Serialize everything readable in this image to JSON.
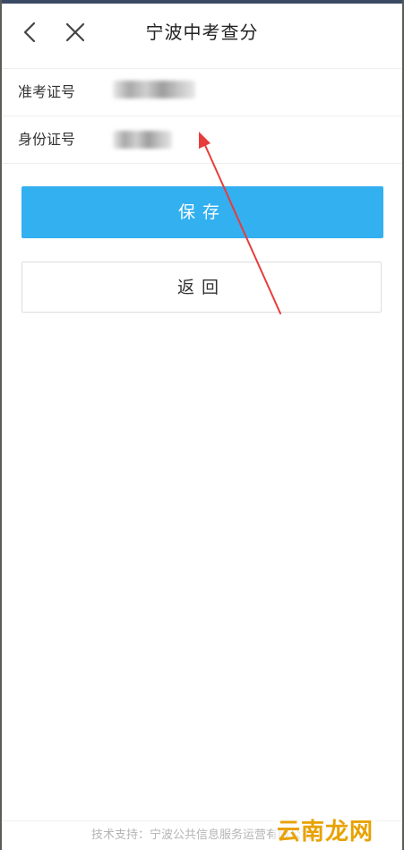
{
  "window": {
    "title": "宁波中考查分"
  },
  "icons": {
    "back": "chevron-left-icon",
    "close": "close-icon"
  },
  "form": {
    "exam_number_label": "准考证号",
    "exam_number_value": "",
    "id_number_label": "身份证号",
    "id_number_value": ""
  },
  "buttons": {
    "save_label": "保存",
    "back_label": "返回"
  },
  "footer": {
    "text": "技术支持：宁波公共信息服务运营有限公司"
  },
  "watermark": {
    "text": "云南龙网"
  },
  "colors": {
    "accent": "#33b0f0",
    "annotation_arrow": "#e83c3c",
    "watermark": "#e8a200"
  }
}
